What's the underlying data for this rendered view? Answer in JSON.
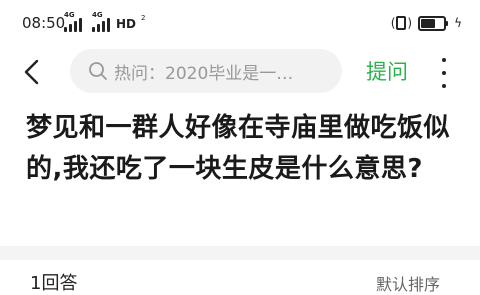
{
  "status_bar": {
    "time": "08:50",
    "sim1_tag": "4G",
    "sim2_tag": "4G",
    "hd_label": "HD",
    "hd_sub": "2"
  },
  "nav": {
    "search_placeholder": "热问：2020毕业是一…",
    "ask_label": "提问"
  },
  "question": {
    "title": "梦见和一群人好像在寺庙里做吃饭似的,我还吃了一块生皮是什么意思?"
  },
  "answers": {
    "label": "1回答",
    "sort": "默认排序"
  },
  "icons": {
    "back": "back-arrow-icon",
    "search": "search-icon",
    "more": "more-vertical-icon",
    "battery": "battery-icon",
    "vibrate": "vibrate-icon",
    "charge": "charging-bolt-icon"
  },
  "colors": {
    "accent": "#2bb24c",
    "search_bg": "#f2f2f2",
    "divider": "#f4f4f4"
  }
}
